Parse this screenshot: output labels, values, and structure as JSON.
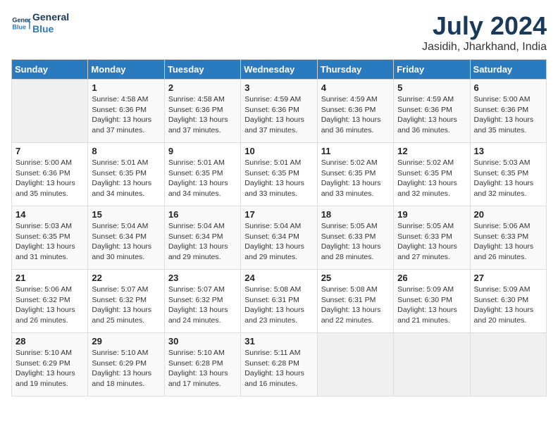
{
  "header": {
    "logo_line1": "General",
    "logo_line2": "Blue",
    "month_year": "July 2024",
    "location": "Jasidih, Jharkhand, India"
  },
  "weekdays": [
    "Sunday",
    "Monday",
    "Tuesday",
    "Wednesday",
    "Thursday",
    "Friday",
    "Saturday"
  ],
  "weeks": [
    [
      {
        "day": "",
        "info": ""
      },
      {
        "day": "1",
        "info": "Sunrise: 4:58 AM\nSunset: 6:36 PM\nDaylight: 13 hours\nand 37 minutes."
      },
      {
        "day": "2",
        "info": "Sunrise: 4:58 AM\nSunset: 6:36 PM\nDaylight: 13 hours\nand 37 minutes."
      },
      {
        "day": "3",
        "info": "Sunrise: 4:59 AM\nSunset: 6:36 PM\nDaylight: 13 hours\nand 37 minutes."
      },
      {
        "day": "4",
        "info": "Sunrise: 4:59 AM\nSunset: 6:36 PM\nDaylight: 13 hours\nand 36 minutes."
      },
      {
        "day": "5",
        "info": "Sunrise: 4:59 AM\nSunset: 6:36 PM\nDaylight: 13 hours\nand 36 minutes."
      },
      {
        "day": "6",
        "info": "Sunrise: 5:00 AM\nSunset: 6:36 PM\nDaylight: 13 hours\nand 35 minutes."
      }
    ],
    [
      {
        "day": "7",
        "info": "Sunrise: 5:00 AM\nSunset: 6:36 PM\nDaylight: 13 hours\nand 35 minutes."
      },
      {
        "day": "8",
        "info": "Sunrise: 5:01 AM\nSunset: 6:35 PM\nDaylight: 13 hours\nand 34 minutes."
      },
      {
        "day": "9",
        "info": "Sunrise: 5:01 AM\nSunset: 6:35 PM\nDaylight: 13 hours\nand 34 minutes."
      },
      {
        "day": "10",
        "info": "Sunrise: 5:01 AM\nSunset: 6:35 PM\nDaylight: 13 hours\nand 33 minutes."
      },
      {
        "day": "11",
        "info": "Sunrise: 5:02 AM\nSunset: 6:35 PM\nDaylight: 13 hours\nand 33 minutes."
      },
      {
        "day": "12",
        "info": "Sunrise: 5:02 AM\nSunset: 6:35 PM\nDaylight: 13 hours\nand 32 minutes."
      },
      {
        "day": "13",
        "info": "Sunrise: 5:03 AM\nSunset: 6:35 PM\nDaylight: 13 hours\nand 32 minutes."
      }
    ],
    [
      {
        "day": "14",
        "info": "Sunrise: 5:03 AM\nSunset: 6:35 PM\nDaylight: 13 hours\nand 31 minutes."
      },
      {
        "day": "15",
        "info": "Sunrise: 5:04 AM\nSunset: 6:34 PM\nDaylight: 13 hours\nand 30 minutes."
      },
      {
        "day": "16",
        "info": "Sunrise: 5:04 AM\nSunset: 6:34 PM\nDaylight: 13 hours\nand 29 minutes."
      },
      {
        "day": "17",
        "info": "Sunrise: 5:04 AM\nSunset: 6:34 PM\nDaylight: 13 hours\nand 29 minutes."
      },
      {
        "day": "18",
        "info": "Sunrise: 5:05 AM\nSunset: 6:33 PM\nDaylight: 13 hours\nand 28 minutes."
      },
      {
        "day": "19",
        "info": "Sunrise: 5:05 AM\nSunset: 6:33 PM\nDaylight: 13 hours\nand 27 minutes."
      },
      {
        "day": "20",
        "info": "Sunrise: 5:06 AM\nSunset: 6:33 PM\nDaylight: 13 hours\nand 26 minutes."
      }
    ],
    [
      {
        "day": "21",
        "info": "Sunrise: 5:06 AM\nSunset: 6:32 PM\nDaylight: 13 hours\nand 26 minutes."
      },
      {
        "day": "22",
        "info": "Sunrise: 5:07 AM\nSunset: 6:32 PM\nDaylight: 13 hours\nand 25 minutes."
      },
      {
        "day": "23",
        "info": "Sunrise: 5:07 AM\nSunset: 6:32 PM\nDaylight: 13 hours\nand 24 minutes."
      },
      {
        "day": "24",
        "info": "Sunrise: 5:08 AM\nSunset: 6:31 PM\nDaylight: 13 hours\nand 23 minutes."
      },
      {
        "day": "25",
        "info": "Sunrise: 5:08 AM\nSunset: 6:31 PM\nDaylight: 13 hours\nand 22 minutes."
      },
      {
        "day": "26",
        "info": "Sunrise: 5:09 AM\nSunset: 6:30 PM\nDaylight: 13 hours\nand 21 minutes."
      },
      {
        "day": "27",
        "info": "Sunrise: 5:09 AM\nSunset: 6:30 PM\nDaylight: 13 hours\nand 20 minutes."
      }
    ],
    [
      {
        "day": "28",
        "info": "Sunrise: 5:10 AM\nSunset: 6:29 PM\nDaylight: 13 hours\nand 19 minutes."
      },
      {
        "day": "29",
        "info": "Sunrise: 5:10 AM\nSunset: 6:29 PM\nDaylight: 13 hours\nand 18 minutes."
      },
      {
        "day": "30",
        "info": "Sunrise: 5:10 AM\nSunset: 6:28 PM\nDaylight: 13 hours\nand 17 minutes."
      },
      {
        "day": "31",
        "info": "Sunrise: 5:11 AM\nSunset: 6:28 PM\nDaylight: 13 hours\nand 16 minutes."
      },
      {
        "day": "",
        "info": ""
      },
      {
        "day": "",
        "info": ""
      },
      {
        "day": "",
        "info": ""
      }
    ]
  ]
}
